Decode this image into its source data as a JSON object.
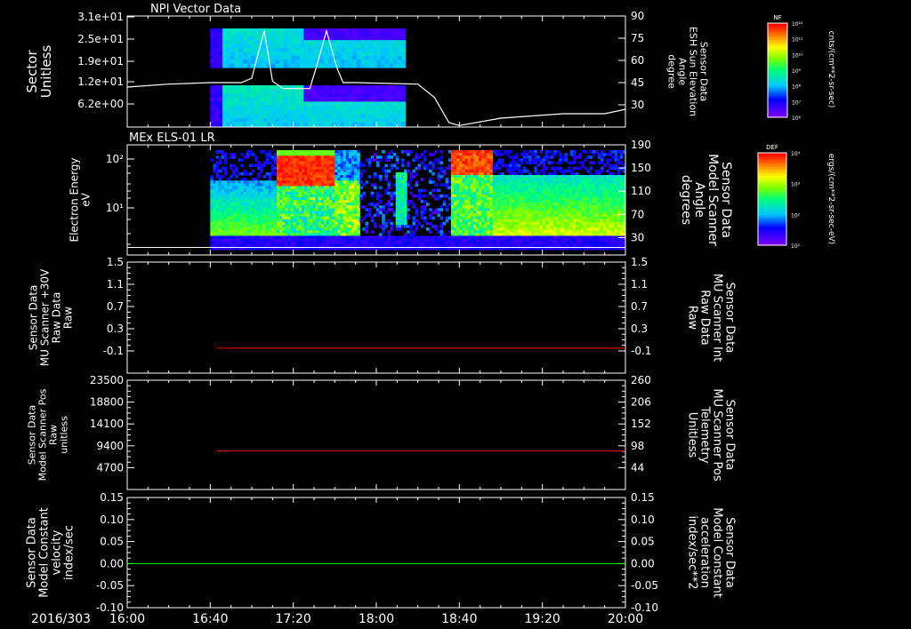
{
  "chart_data": [
    {
      "panel": "npi",
      "type": "heatmap",
      "title": "NPI Vector Data",
      "ylabel_left": [
        "Sector",
        "Unitless"
      ],
      "yticks_left": [
        "3.1e+01",
        "2.5e+01",
        "1.9e+01",
        "1.2e+01",
        "6.2e+00"
      ],
      "ylabel_right": [
        "Sensor Data",
        "ESH Sun Elevation",
        "Angle",
        "degree"
      ],
      "yticks_right": [
        "90",
        "75",
        "60",
        "45",
        "30"
      ],
      "ylim_right": [
        15,
        90
      ],
      "colorbar": {
        "label": "NF",
        "units": "cnts/(cm**2-sr-sec)",
        "ticks": [
          "10¹²",
          "10¹¹",
          "10¹⁰",
          "10⁹",
          "10⁸",
          "10⁷",
          "10⁶"
        ]
      },
      "overlay_line": {
        "name": "ESH Sun Elevation",
        "color": "#ffffff",
        "points": [
          [
            0,
            42
          ],
          [
            20,
            44
          ],
          [
            40,
            45
          ],
          [
            55,
            45
          ],
          [
            60,
            48
          ],
          [
            66,
            80
          ],
          [
            70,
            46
          ],
          [
            75,
            41
          ],
          [
            88,
            41
          ],
          [
            91,
            55
          ],
          [
            96,
            80
          ],
          [
            101,
            55
          ],
          [
            104,
            45
          ],
          [
            110,
            45
          ],
          [
            140,
            44
          ],
          [
            148,
            35
          ],
          [
            155,
            18
          ],
          [
            160,
            16
          ],
          [
            180,
            21
          ],
          [
            210,
            24
          ],
          [
            230,
            24
          ],
          [
            240,
            27
          ]
        ]
      }
    },
    {
      "panel": "els",
      "type": "heatmap",
      "title": "MEx ELS-01 LR",
      "ylabel_left": [
        "Electron Energy",
        "eV"
      ],
      "yticks_left": [
        "10²",
        "10¹"
      ],
      "ylabel_right": [
        "Sensor Data",
        "Model Scanner",
        "Angle",
        "degrees"
      ],
      "yticks_right": [
        "190",
        "150",
        "110",
        "70",
        "30"
      ],
      "ylim_right": [
        0,
        190
      ],
      "colorbar": {
        "label": "DEF",
        "units": "ergs/(cm**2-sr-sec-eV)",
        "ticks": [
          "10⁴",
          "10³",
          "10²",
          "10¹"
        ]
      },
      "overlay_line": {
        "name": "Model Scanner Angle",
        "color": "#ffffff",
        "value": 13,
        "start_minute": 0
      }
    },
    {
      "panel": "p3",
      "type": "line",
      "ylabel_left": [
        "Sensor Data",
        "MU Scanner +30V",
        "Raw Data",
        "Raw"
      ],
      "yticks_left": [
        "1.5",
        "1.1",
        "0.7",
        "0.3",
        "-0.1"
      ],
      "ylim_left": [
        -0.5,
        1.5
      ],
      "ylabel_right": [
        "Sensor Data",
        "MU Scanner Int",
        "Raw Data",
        "Raw"
      ],
      "yticks_right": [
        "1.5",
        "1.1",
        "0.7",
        "0.3",
        "-0.1"
      ],
      "right_color": "#ff0000",
      "series": [
        {
          "color": "#ff0000",
          "start_minute": 43,
          "value": -0.05
        }
      ]
    },
    {
      "panel": "p4",
      "type": "line",
      "ylabel_left": [
        "Sensor Data",
        "Model Scanner Pos",
        "Raw",
        "unitless"
      ],
      "yticks_left": [
        "23500",
        "18800",
        "14100",
        "9400",
        "4700"
      ],
      "ylim_left": [
        0,
        23500
      ],
      "ylabel_right": [
        "Sensor Data",
        "MU Scanner Pos",
        "Telemetry",
        "Unitless"
      ],
      "yticks_right": [
        "260",
        "206",
        "152",
        "98",
        "44"
      ],
      "right_color": "#ff0000",
      "series": [
        {
          "color": "#ff0000",
          "start_minute": 43,
          "value": 8300
        }
      ]
    },
    {
      "panel": "p5",
      "type": "line",
      "ylabel_left": [
        "Sensor Data",
        "Model Constant",
        "velocity",
        "index/sec"
      ],
      "yticks_left": [
        "0.15",
        "0.10",
        "0.05",
        "0.00",
        "-0.05",
        "-0.10"
      ],
      "ylim_left": [
        -0.1,
        0.15
      ],
      "ylabel_right": [
        "Sensor Data",
        "Model Constant",
        "acceleration",
        "index/sec**2"
      ],
      "yticks_right": [
        "0.15",
        "0.10",
        "0.05",
        "0.00",
        "-0.05",
        "-0.10"
      ],
      "right_color": "#00ff00",
      "series": [
        {
          "color": "#00ff00",
          "start_minute": 0,
          "value": 0.0
        }
      ]
    }
  ],
  "time_axis": {
    "date_label": "2016/303",
    "tick_labels": [
      "16:00",
      "16:40",
      "17:20",
      "18:00",
      "18:40",
      "19:20",
      "20:00"
    ],
    "tick_minutes": [
      0,
      40,
      80,
      120,
      160,
      200,
      240
    ],
    "range_minutes": [
      0,
      240
    ]
  }
}
